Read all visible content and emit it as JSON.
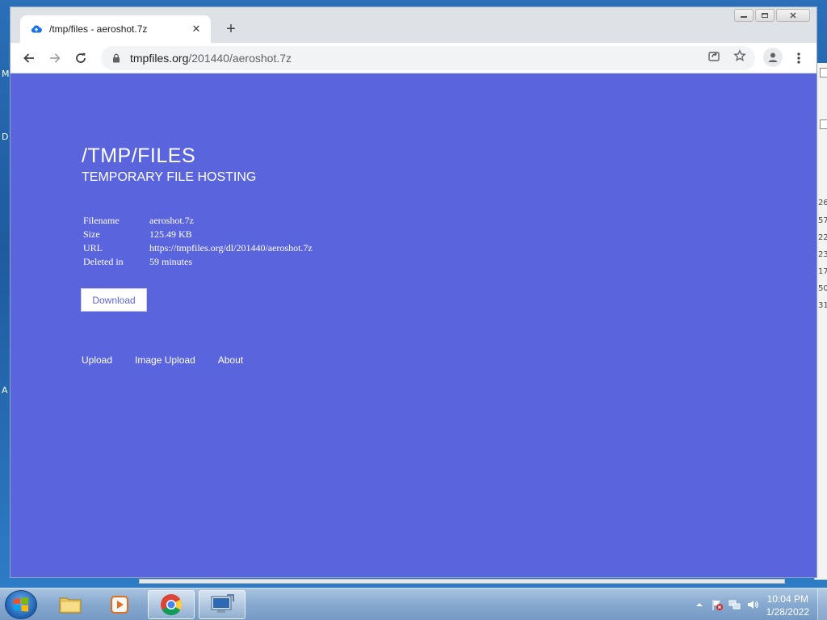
{
  "desktop": {
    "fragments": [
      "M",
      "D",
      "A"
    ]
  },
  "background_window": {
    "numbers": [
      "26",
      "57",
      "22",
      "23",
      "17",
      "50",
      "31"
    ]
  },
  "browser": {
    "tab": {
      "title": "/tmp/files - aeroshot.7z",
      "favicon": "cloud-upload-icon",
      "close": "✕"
    },
    "new_tab": "+",
    "address": {
      "domain": "tmpfiles.org",
      "path": "/201440/aeroshot.7z"
    }
  },
  "page": {
    "title": "/TMP/FILES",
    "subtitle": "TEMPORARY FILE HOSTING",
    "info": [
      {
        "key": "Filename",
        "value": "aeroshot.7z"
      },
      {
        "key": "Size",
        "value": "125.49 KB"
      },
      {
        "key": "URL",
        "value": "https://tmpfiles.org/dl/201440/aeroshot.7z"
      },
      {
        "key": "Deleted in",
        "value": "59 minutes"
      }
    ],
    "download_label": "Download",
    "footer_links": [
      "Upload",
      "Image Upload",
      "About"
    ],
    "background_color": "#5a64dc"
  },
  "taskbar": {
    "clock_time": "10:04 PM",
    "clock_date": "1/28/2022"
  }
}
